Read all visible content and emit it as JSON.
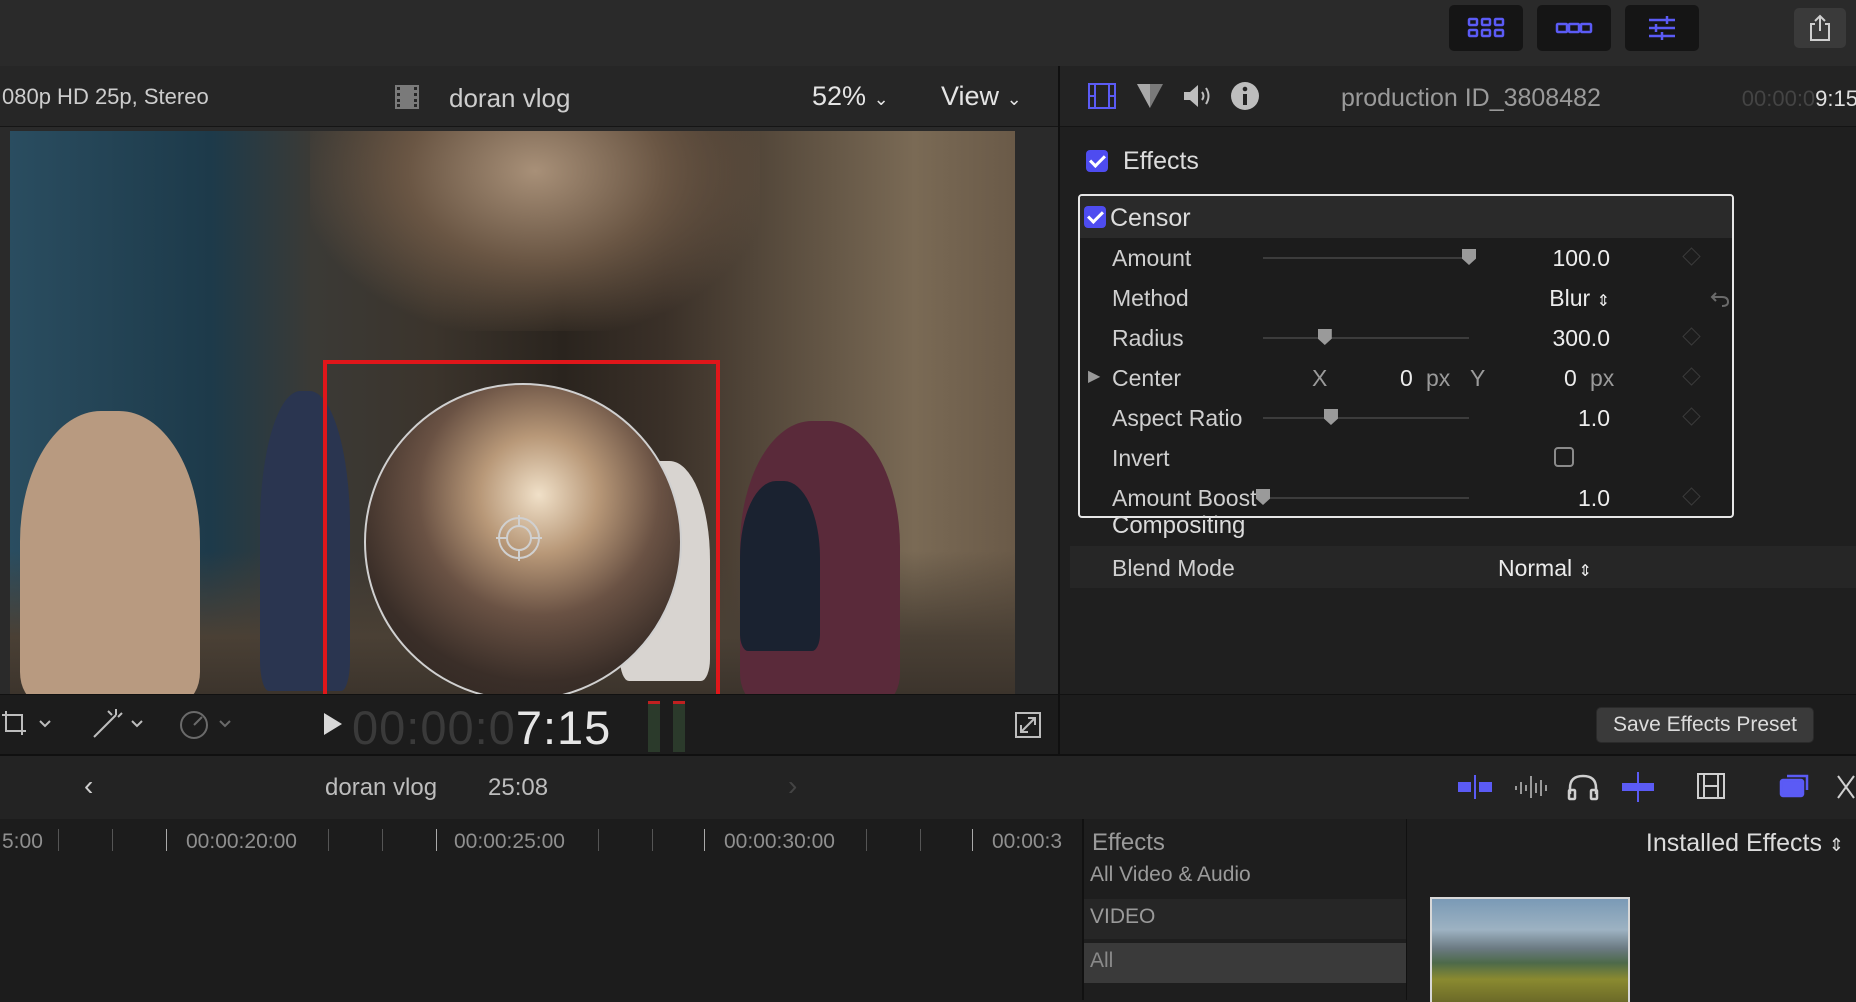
{
  "viewer": {
    "format": "080p HD 25p, Stereo",
    "clip_name": "doran vlog",
    "zoom": "52%",
    "view_menu": "View",
    "timecode_dim": "00:00:0",
    "timecode_bright": "7:15"
  },
  "inspector": {
    "clip_title": "production ID_3808482",
    "time_dim": "00:00:0",
    "time_bright": "9:15",
    "effects_label": "Effects",
    "censor": {
      "label": "Censor",
      "amount": {
        "label": "Amount",
        "value": "100.0",
        "level": 1.0
      },
      "method": {
        "label": "Method",
        "value": "Blur"
      },
      "radius": {
        "label": "Radius",
        "value": "300.0",
        "level": 0.3
      },
      "center": {
        "label": "Center",
        "x_label": "X",
        "x_value": "0",
        "x_unit": "px",
        "y_label": "Y",
        "y_value": "0",
        "y_unit": "px"
      },
      "aspect_ratio": {
        "label": "Aspect Ratio",
        "value": "1.0",
        "level": 0.33
      },
      "invert": {
        "label": "Invert",
        "checked": false
      },
      "amount_boost": {
        "label": "Amount Boost",
        "value": "1.0",
        "level": 0.0
      }
    },
    "compositing_label": "Compositing",
    "blend_mode": {
      "label": "Blend Mode",
      "value": "Normal"
    },
    "save_preset_label": "Save Effects Preset"
  },
  "timeline": {
    "project": "doran vlog",
    "duration": "25:08",
    "ruler_labels": [
      "5:00",
      "00:00:20:00",
      "00:00:25:00",
      "00:00:30:00",
      "00:00:3"
    ]
  },
  "effects_browser": {
    "header": "Effects",
    "installed": "Installed Effects",
    "items": [
      "All Video & Audio",
      "VIDEO",
      "All"
    ]
  },
  "colors": {
    "accent": "#4e4cf0",
    "censor_box": "#e0161a",
    "panel": "#1f1f1f"
  }
}
